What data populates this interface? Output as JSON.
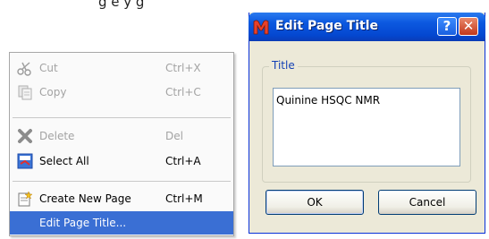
{
  "top_fragment": "g       e     y      g",
  "context_menu": {
    "items": [
      {
        "label": "Cut",
        "shortcut": "Ctrl+X",
        "icon": "scissors-icon",
        "enabled": false
      },
      {
        "label": "Copy",
        "shortcut": "Ctrl+C",
        "icon": "copy-icon",
        "enabled": false
      },
      {
        "label": "Delete",
        "shortcut": "Del",
        "icon": "delete-x-icon",
        "enabled": false
      },
      {
        "label": "Select All",
        "shortcut": "Ctrl+A",
        "icon": "select-all-icon",
        "enabled": true
      },
      {
        "label": "Create New Page",
        "shortcut": "Ctrl+M",
        "icon": "new-page-icon",
        "enabled": true
      },
      {
        "label": "Edit Page Title...",
        "shortcut": "",
        "enabled": true,
        "selected": true
      }
    ],
    "selection_color": "#3a6fd4"
  },
  "dialog": {
    "title": "Edit Page Title",
    "help_glyph": "?",
    "close_glyph": "✕",
    "group_label": "Title",
    "title_value": "Quinine HSQC NMR",
    "ok_label": "OK",
    "cancel_label": "Cancel",
    "titlebar_color": "#0447d0"
  }
}
